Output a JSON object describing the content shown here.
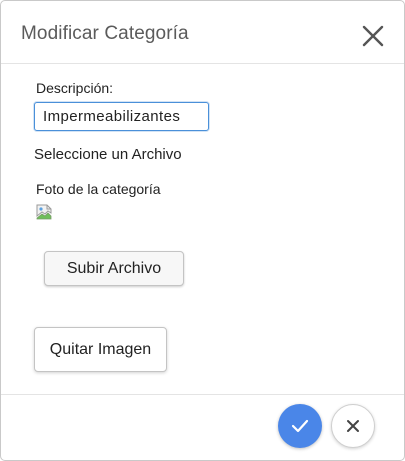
{
  "dialog": {
    "title": "Modificar Categoría"
  },
  "form": {
    "description_label": "Descripción:",
    "description_value": "Impermeabilizantes",
    "select_file_text": "Seleccione un Archivo",
    "photo_label": "Foto de la categoría"
  },
  "buttons": {
    "upload_label": "Subir Archivo",
    "remove_label": "Quitar Imagen"
  },
  "icons": {
    "close": "close-icon",
    "broken_image": "broken-image-icon",
    "confirm": "check-icon",
    "cancel": "x-icon"
  },
  "colors": {
    "primary": "#4a86e8",
    "input_focus_border": "#4a90d9"
  }
}
